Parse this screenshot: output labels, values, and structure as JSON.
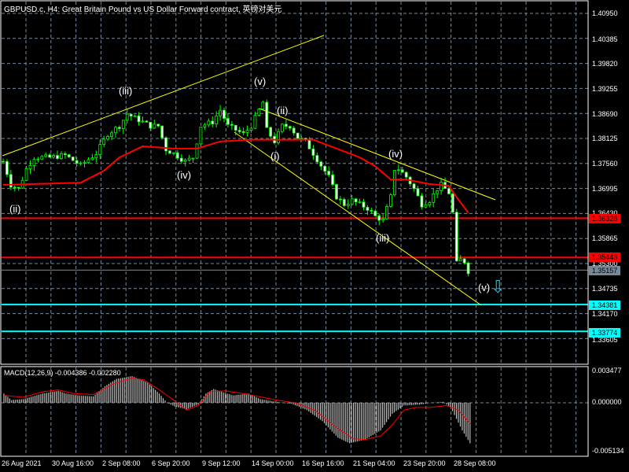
{
  "header": {
    "title": "GBPUSD.c, H4:  Great Britain Pound vs US Dollar Forward contract, 英镑对美元"
  },
  "colors": {
    "bull_wick": "#00ff00",
    "ma": "#ff0000",
    "trend": "#ffff00",
    "support": "#00ffff",
    "resistance": "#ff0000",
    "grid": "#778899",
    "current": "#778899"
  },
  "price_axis": [
    "1.40950",
    "1.40385",
    "1.39820",
    "1.39255",
    "1.38690",
    "1.38125",
    "1.37560",
    "1.36995",
    "1.36430",
    "1.35865",
    "1.35300",
    "1.34735",
    "1.34170",
    "1.33605"
  ],
  "levels": [
    {
      "label": "1.36328",
      "price": 1.36328,
      "kind": "resistance"
    },
    {
      "label": "1.35443",
      "price": 1.35443,
      "kind": "resistance"
    },
    {
      "label": "1.35157",
      "price": 1.35157,
      "kind": "current"
    },
    {
      "label": "1.34381",
      "price": 1.34381,
      "kind": "support"
    },
    {
      "label": "1.33774",
      "price": 1.33774,
      "kind": "support"
    }
  ],
  "waves": [
    "(ii)",
    "(iii)",
    "(iv)",
    "(v)",
    "(i)",
    "(ii)",
    "(iii)",
    "(iv)",
    "(v)"
  ],
  "time_axis": [
    "26 Aug 2021",
    "30 Aug 16:00",
    "2 Sep 08:00",
    "6 Sep 20:00",
    "9 Sep 12:00",
    "14 Sep 00:00",
    "16 Sep 16:00",
    "21 Sep 04:00",
    "23 Sep 20:00",
    "28 Sep 08:00"
  ],
  "macd": {
    "label": "MACD(12,26,9) -0.004386 -0.002280",
    "axis": [
      "0.003477",
      "0.000000",
      "-0.005134"
    ]
  },
  "chart_data": {
    "type": "candlestick",
    "symbol": "GBPUSD.c",
    "timeframe": "H4",
    "price_keypoints": [
      [
        0,
        1.3761
      ],
      [
        2,
        1.3708
      ],
      [
        4,
        1.3699
      ],
      [
        6,
        1.3744
      ],
      [
        8,
        1.377
      ],
      [
        12,
        1.377
      ],
      [
        16,
        1.3775
      ],
      [
        20,
        1.3752
      ],
      [
        24,
        1.3779
      ],
      [
        27,
        1.3823
      ],
      [
        30,
        1.3841
      ],
      [
        32,
        1.3868
      ],
      [
        34,
        1.3859
      ],
      [
        38,
        1.3841
      ],
      [
        40,
        1.3841
      ],
      [
        42,
        1.3788
      ],
      [
        44,
        1.3779
      ],
      [
        47,
        1.3761
      ],
      [
        49,
        1.377
      ],
      [
        51,
        1.3841
      ],
      [
        54,
        1.385
      ],
      [
        56,
        1.3877
      ],
      [
        58,
        1.3841
      ],
      [
        60,
        1.3832
      ],
      [
        62,
        1.3823
      ],
      [
        64,
        1.3841
      ],
      [
        66,
        1.3877
      ],
      [
        67,
        1.3894
      ],
      [
        68,
        1.3832
      ],
      [
        70,
        1.3806
      ],
      [
        72,
        1.3841
      ],
      [
        74,
        1.3841
      ],
      [
        76,
        1.3815
      ],
      [
        78,
        1.3806
      ],
      [
        80,
        1.3779
      ],
      [
        82,
        1.3752
      ],
      [
        84,
        1.3726
      ],
      [
        86,
        1.3681
      ],
      [
        88,
        1.3664
      ],
      [
        90,
        1.3673
      ],
      [
        92,
        1.3664
      ],
      [
        94,
        1.3655
      ],
      [
        96,
        1.3637
      ],
      [
        98,
        1.3628
      ],
      [
        99,
        1.3655
      ],
      [
        100,
        1.3681
      ],
      [
        101,
        1.3744
      ],
      [
        102,
        1.3744
      ],
      [
        104,
        1.3726
      ],
      [
        106,
        1.3699
      ],
      [
        108,
        1.3664
      ],
      [
        110,
        1.3673
      ],
      [
        112,
        1.3699
      ],
      [
        113,
        1.3708
      ],
      [
        115,
        1.369
      ],
      [
        116,
        1.3645
      ],
      [
        117,
        1.3531
      ],
      [
        118,
        1.3539
      ],
      [
        119,
        1.3535
      ],
      [
        120,
        1.3513
      ]
    ],
    "ma_keypoints": [
      [
        0,
        1.3708
      ],
      [
        20,
        1.3713
      ],
      [
        26,
        1.374
      ],
      [
        30,
        1.377
      ],
      [
        36,
        1.3795
      ],
      [
        44,
        1.379
      ],
      [
        50,
        1.379
      ],
      [
        56,
        1.3806
      ],
      [
        64,
        1.381
      ],
      [
        72,
        1.381
      ],
      [
        80,
        1.381
      ],
      [
        86,
        1.379
      ],
      [
        92,
        1.377
      ],
      [
        96,
        1.375
      ],
      [
        100,
        1.372
      ],
      [
        104,
        1.372
      ],
      [
        110,
        1.371
      ],
      [
        115,
        1.3706
      ],
      [
        117,
        1.368
      ],
      [
        120,
        1.3645
      ]
    ],
    "macd_hist_keypoints": [
      [
        0,
        0.001
      ],
      [
        4,
        0.0003
      ],
      [
        10,
        0.0004
      ],
      [
        20,
        0.001
      ],
      [
        28,
        0.0013
      ],
      [
        32,
        0.001
      ],
      [
        38,
        0.0008
      ],
      [
        46,
        0.0007
      ],
      [
        52,
        0.0018
      ],
      [
        58,
        0.0026
      ],
      [
        66,
        0.0029
      ],
      [
        74,
        0.0022
      ],
      [
        80,
        0.001
      ],
      [
        84,
        0.0
      ],
      [
        88,
        -0.0004
      ],
      [
        94,
        -0.0007
      ],
      [
        100,
        -0.0002
      ],
      [
        104,
        0.001
      ],
      [
        108,
        0.0015
      ],
      [
        112,
        0.0012
      ],
      [
        118,
        0.0008
      ],
      [
        126,
        0.001
      ],
      [
        132,
        0.0004
      ],
      [
        140,
        0.0001
      ],
      [
        148,
        -0.0001
      ],
      [
        156,
        -0.0008
      ],
      [
        164,
        -0.002
      ],
      [
        172,
        -0.0038
      ],
      [
        178,
        -0.0044
      ],
      [
        186,
        -0.004
      ],
      [
        194,
        -0.003
      ],
      [
        200,
        -0.0012
      ],
      [
        206,
        -0.0003
      ],
      [
        214,
        -0.0002
      ],
      [
        220,
        0.0
      ],
      [
        226,
        0.0001
      ],
      [
        230,
        -0.0005
      ],
      [
        236,
        -0.003
      ],
      [
        240,
        -0.0044
      ]
    ],
    "macd_signal_keypoints": [
      [
        0,
        0.0008
      ],
      [
        10,
        0.0006
      ],
      [
        20,
        0.0012
      ],
      [
        28,
        0.0014
      ],
      [
        36,
        0.001
      ],
      [
        46,
        0.0009
      ],
      [
        56,
        0.002
      ],
      [
        66,
        0.0027
      ],
      [
        72,
        0.0025
      ],
      [
        80,
        0.0014
      ],
      [
        88,
        0.0002
      ],
      [
        94,
        -0.0008
      ],
      [
        100,
        -0.0003
      ],
      [
        106,
        0.0012
      ],
      [
        114,
        0.0013
      ],
      [
        126,
        0.0009
      ],
      [
        140,
        0.0003
      ],
      [
        150,
        0.0
      ],
      [
        160,
        -0.0008
      ],
      [
        170,
        -0.0025
      ],
      [
        180,
        -0.0039
      ],
      [
        186,
        -0.004
      ],
      [
        194,
        -0.0036
      ],
      [
        200,
        -0.0024
      ],
      [
        206,
        -0.0008
      ],
      [
        212,
        -0.0005
      ],
      [
        220,
        -0.0005
      ],
      [
        228,
        -0.0003
      ],
      [
        234,
        -0.0008
      ],
      [
        240,
        -0.0023
      ]
    ]
  }
}
